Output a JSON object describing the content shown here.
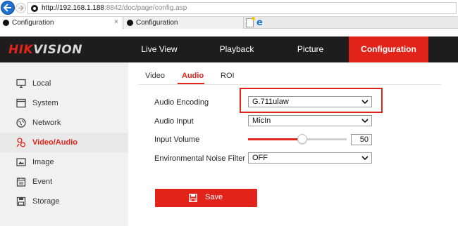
{
  "browser": {
    "url_host": "http://192.168.1.188",
    "url_rest": ":8842/doc/page/config.asp",
    "tabs": [
      {
        "label": "Configuration",
        "close": "×"
      },
      {
        "label": "Configuration"
      }
    ]
  },
  "header": {
    "logo_part1": "HIK",
    "logo_part2": "VISION",
    "nav": [
      "Live View",
      "Playback",
      "Picture",
      "Configuration"
    ],
    "active_nav": "Configuration"
  },
  "sidebar": {
    "items": [
      {
        "label": "Local",
        "icon": "monitor-icon"
      },
      {
        "label": "System",
        "icon": "window-icon"
      },
      {
        "label": "Network",
        "icon": "globe-icon"
      },
      {
        "label": "Video/Audio",
        "icon": "video-audio-icon",
        "active": true
      },
      {
        "label": "Image",
        "icon": "image-icon"
      },
      {
        "label": "Event",
        "icon": "calendar-icon"
      },
      {
        "label": "Storage",
        "icon": "floppy-icon"
      }
    ]
  },
  "content_tabs": [
    "Video",
    "Audio",
    "ROI"
  ],
  "active_tab": "Audio",
  "form": {
    "audio_encoding_label": "Audio Encoding",
    "audio_encoding_value": "G.711ulaw",
    "audio_input_label": "Audio Input",
    "audio_input_value": "MicIn",
    "input_volume_label": "Input Volume",
    "input_volume_value": "50",
    "input_volume_level_fraction": 0.55,
    "noise_filter_label": "Environmental Noise Filter",
    "noise_filter_value": "OFF"
  },
  "save_label": "Save",
  "colors": {
    "accent": "#e2231a",
    "header_bg": "#1d1d1d",
    "sidebar_bg": "#f1f1f1"
  }
}
